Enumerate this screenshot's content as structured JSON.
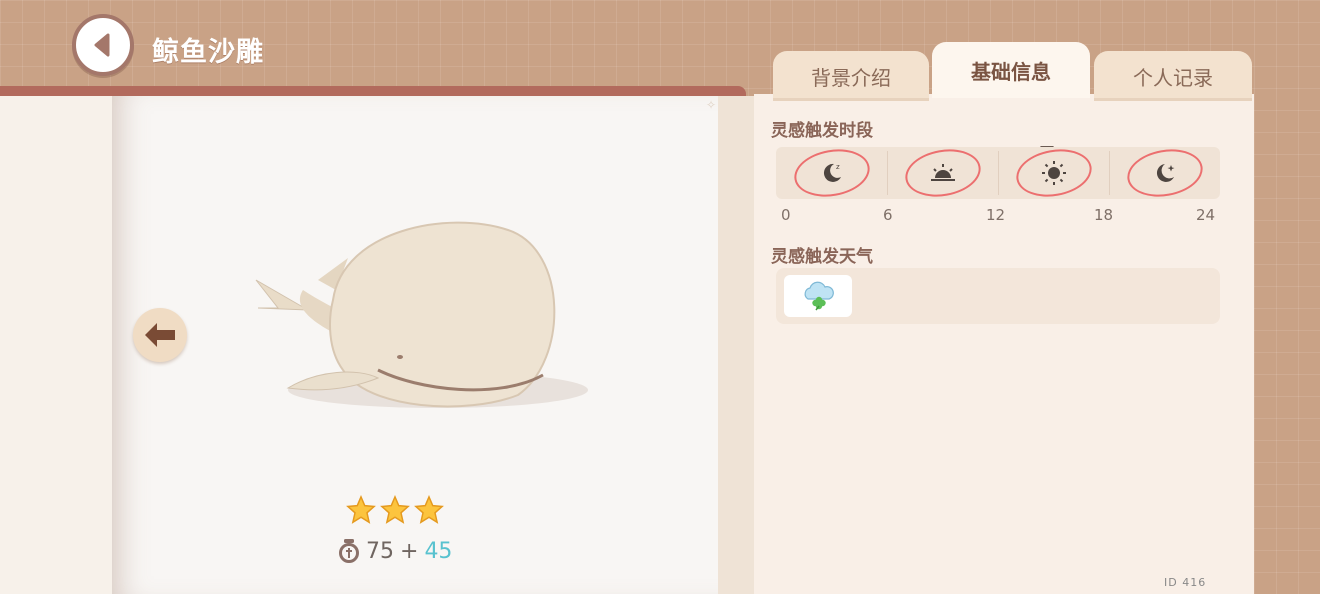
{
  "header": {
    "title": "鲸鱼沙雕"
  },
  "tabs": [
    {
      "label": "背景介绍",
      "active": false
    },
    {
      "label": "基础信息",
      "active": true
    },
    {
      "label": "个人记录",
      "active": false
    }
  ],
  "item": {
    "stars": 3,
    "price_base": "75",
    "price_plus": "+",
    "price_bonus": "45"
  },
  "inspiration_time": {
    "title": "灵感触发时段",
    "ticks": [
      "0",
      "6",
      "12",
      "18",
      "24"
    ],
    "segments": [
      {
        "icon": "moon-sleep-icon",
        "selected": true
      },
      {
        "icon": "sunrise-icon",
        "selected": true
      },
      {
        "icon": "sun-icon",
        "selected": true,
        "current": true
      },
      {
        "icon": "moon-star-icon",
        "selected": true
      }
    ]
  },
  "inspiration_weather": {
    "title": "灵感触发天气",
    "items": [
      {
        "icon": "cloud-clover-icon"
      }
    ]
  },
  "watermark": "ID 416"
}
